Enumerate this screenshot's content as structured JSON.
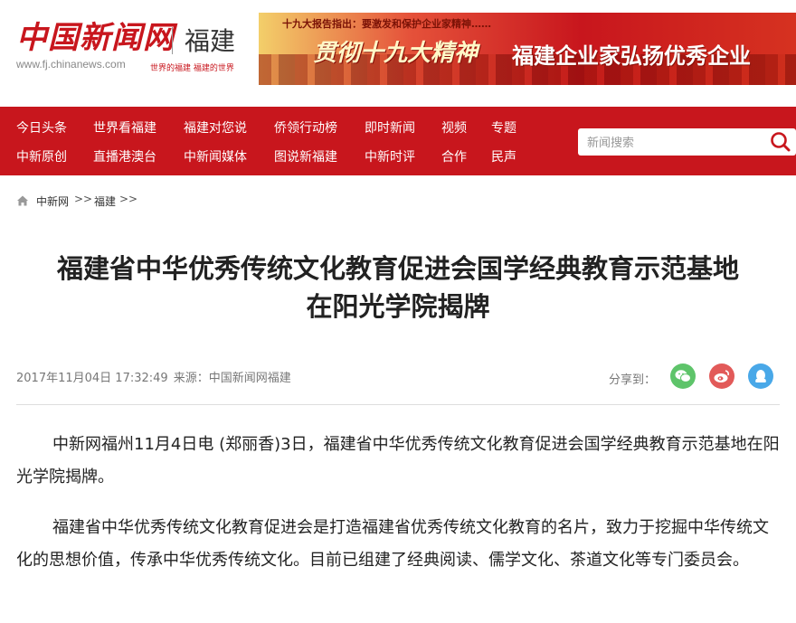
{
  "header": {
    "logo_text": "中国新闻网",
    "region": "福建",
    "url": "www.fj.chinanews.com",
    "slogan": "世界的福建  福建的世界",
    "banner": {
      "small_text": "十九大报告指出：要激发和保护企业家精神……",
      "main_text_1": "贯彻十九大精神",
      "main_text_2": "福建企业家弘扬优秀企业"
    }
  },
  "nav": {
    "row1": [
      "今日头条",
      "世界看福建",
      "福建对您说",
      "侨领行动榜",
      "即时新闻",
      "视频",
      "专题"
    ],
    "row2": [
      "中新原创",
      "直播港澳台",
      "中新闻媒体",
      "图说新福建",
      "中新时评",
      "合作",
      "民声"
    ]
  },
  "search": {
    "placeholder": "新闻搜索"
  },
  "breadcrumb": {
    "items": [
      "中新网",
      "福建"
    ],
    "separator": ">>"
  },
  "article": {
    "title_line1": "福建省中华优秀传统文化教育促进会国学经典教育示范基地",
    "title_line2": "在阳光学院揭牌",
    "date": "2017年11月04日 17:32:49",
    "source": "来源：中国新闻网福建",
    "share_label": "分享到：",
    "paragraphs": [
      "中新网福州11月4日电 (郑丽香)3日，福建省中华优秀传统文化教育促进会国学经典教育示范基地在阳光学院揭牌。",
      "福建省中华优秀传统文化教育促进会是打造福建省优秀传统文化教育的名片，致力于挖掘中华传统文化的思想价值，传承中华优秀传统文化。目前已组建了经典阅读、儒学文化、茶道文化等专门委员会。"
    ]
  },
  "colors": {
    "brand_red": "#c8161d",
    "wechat": "#5ec46a",
    "weibo": "#e25a59",
    "qq": "#49a8e8"
  },
  "icons": [
    "home-icon",
    "search-icon",
    "wechat-icon",
    "weibo-icon",
    "qq-icon"
  ]
}
